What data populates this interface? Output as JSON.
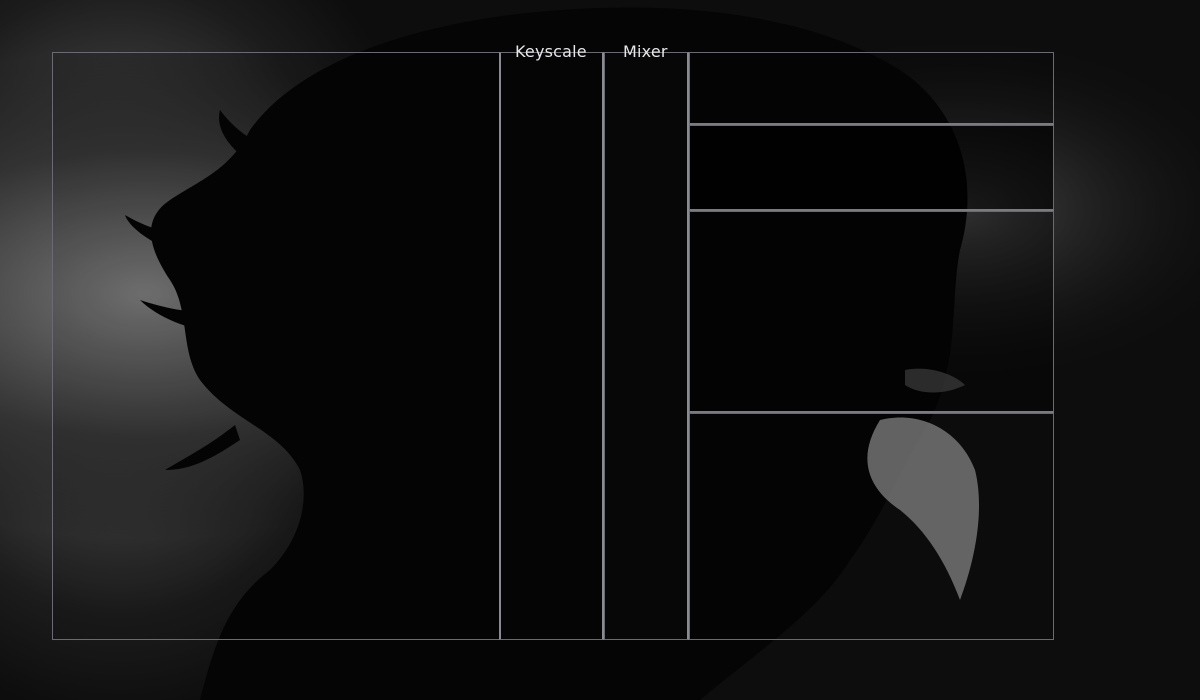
{
  "sections": {
    "keyscale_label": "Keyscale",
    "mixer_label": "Mixer"
  },
  "colors": {
    "panel_border": "#6a6a72",
    "divider": "#8a8a92",
    "label_text": "#e6e6ea"
  }
}
